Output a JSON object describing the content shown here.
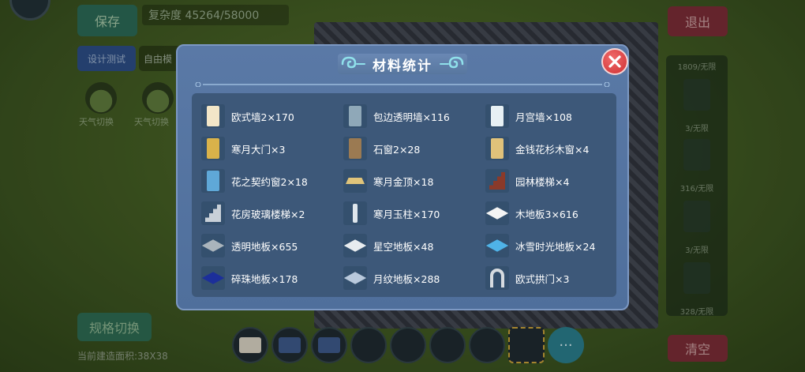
{
  "background": {
    "save_label": "保存",
    "complexity_text": "复杂度 45264/58000",
    "exit_label": "退出",
    "design_test_label": "设计测试",
    "mode_label": "自由模",
    "round_labels": [
      "天气切换",
      "天气切换"
    ],
    "right_panel_labels": [
      "1809/无限",
      "3/无限",
      "316/无限",
      "3/无限",
      "328/无限"
    ],
    "switch_label": "规格切换",
    "area_text": "当前建造面积:38X38",
    "clear_label": "清空",
    "more_label": "···"
  },
  "modal": {
    "title": "材料统计",
    "items": [
      {
        "name": "欧式墙2",
        "count": "×170",
        "icon": "wall-panel-icon",
        "color": "#f2e6c8"
      },
      {
        "name": "包边透明墙",
        "count": "×116",
        "icon": "glass-wall-icon",
        "color": "#8fa8b8"
      },
      {
        "name": "月宫墙",
        "count": "×108",
        "icon": "moon-wall-icon",
        "color": "#e7f0f4"
      },
      {
        "name": "寒月大门",
        "count": "×3",
        "icon": "door-icon",
        "color": "#d9b24a"
      },
      {
        "name": "石窗2",
        "count": "×28",
        "icon": "stone-window-icon",
        "color": "#9b7a52"
      },
      {
        "name": "金钱花杉木窗",
        "count": "×4",
        "icon": "wood-window-icon",
        "color": "#e0c27a"
      },
      {
        "name": "花之契约窗2",
        "count": "×18",
        "icon": "flower-window-icon",
        "color": "#5fa8d8"
      },
      {
        "name": "寒月金顶",
        "count": "×18",
        "icon": "gold-roof-icon",
        "color": "#e0c47a"
      },
      {
        "name": "园林楼梯",
        "count": "×4",
        "icon": "garden-stairs-icon",
        "color": "#8a3a2a"
      },
      {
        "name": "花房玻璃楼梯",
        "count": "×2",
        "icon": "glass-stairs-icon",
        "color": "#c8d0d8"
      },
      {
        "name": "寒月玉柱",
        "count": "×170",
        "icon": "jade-pillar-icon",
        "color": "#dfe6ec"
      },
      {
        "name": "木地板3",
        "count": "×616",
        "icon": "wood-floor-icon",
        "color": "#f4f4f4"
      },
      {
        "name": "透明地板",
        "count": "×655",
        "icon": "glass-floor-icon",
        "color": "#aab4bc"
      },
      {
        "name": "星空地板",
        "count": "×48",
        "icon": "starry-floor-icon",
        "color": "#e8ecef"
      },
      {
        "name": "冰雪时光地板",
        "count": "×24",
        "icon": "ice-floor-icon",
        "color": "#4fb3e8"
      },
      {
        "name": "碎珠地板",
        "count": "×178",
        "icon": "pearl-floor-icon",
        "color": "#1c2f9a"
      },
      {
        "name": "月纹地板",
        "count": "×288",
        "icon": "moon-floor-icon",
        "color": "#b9c9dc"
      },
      {
        "name": "欧式拱门",
        "count": "×3",
        "icon": "arch-door-icon",
        "color": "#d6dbe0"
      }
    ]
  }
}
